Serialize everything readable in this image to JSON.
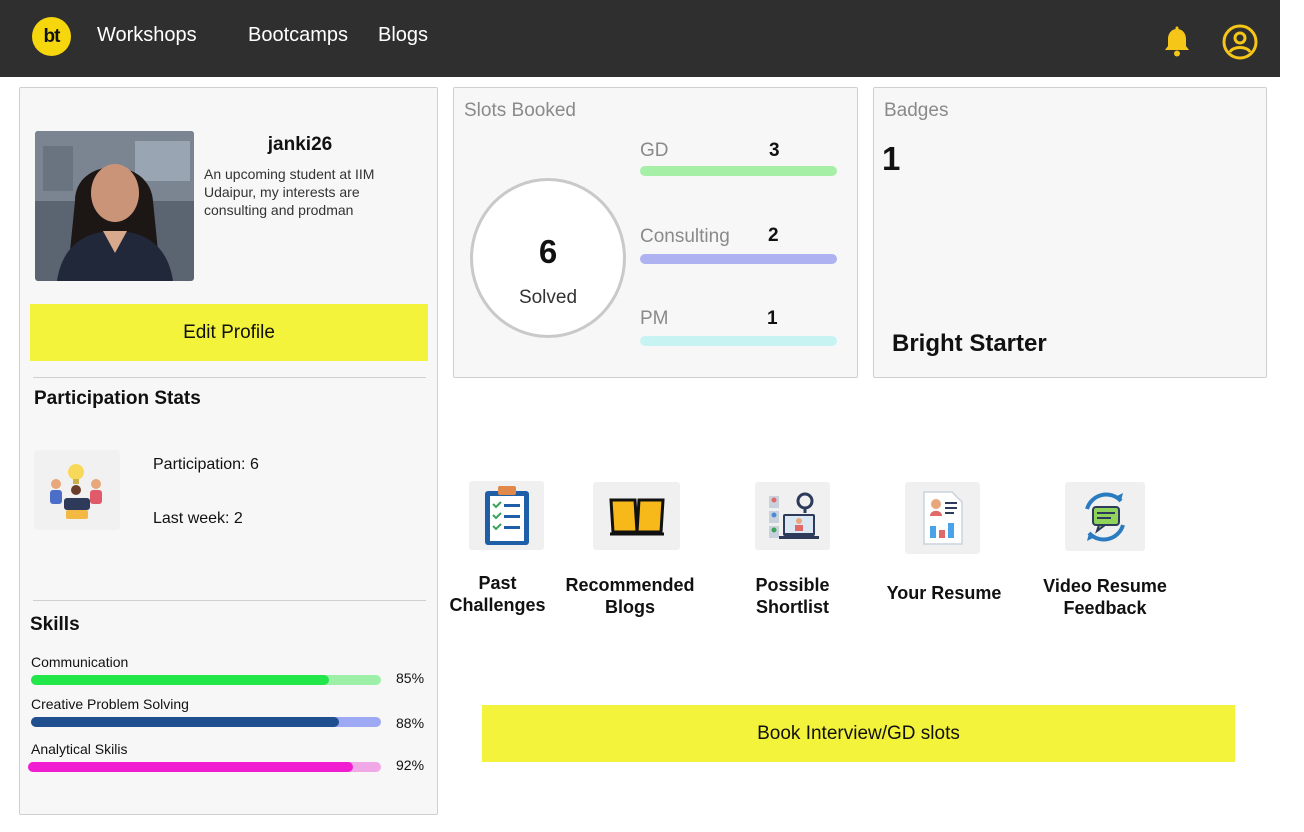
{
  "header": {
    "logo_text": "bt",
    "nav": [
      "Workshops",
      "Bootcamps",
      "Blogs"
    ],
    "icons": [
      "bell-icon",
      "user-account-icon"
    ],
    "background_color": "#2f2f2f",
    "accent_color": "#f6d70e"
  },
  "profile": {
    "username": "janki26",
    "bio": "An upcoming student at IIM Udaipur, my interests are consulting and prodman",
    "edit_label": "Edit Profile"
  },
  "participation": {
    "title": "Participation Stats",
    "participation_text": "Participation: 6",
    "last_week_text": "Last week: 2"
  },
  "skills": {
    "title": "Skills",
    "items": [
      {
        "name": "Communication",
        "percent": 85,
        "percent_label": "85%",
        "fill_color": "#22e64a",
        "track_color": "#9ef0a8"
      },
      {
        "name": "Creative Problem Solving",
        "percent": 88,
        "percent_label": "88%",
        "fill_color": "#1f4f8f",
        "track_color": "#9ea9f3"
      },
      {
        "name": "Analytical Skilis",
        "percent": 92,
        "percent_label": "92%",
        "fill_color": "#f01ed0",
        "track_color": "#f1a8e6"
      }
    ]
  },
  "slots": {
    "title": "Slots Booked",
    "solved_count": "6",
    "solved_label": "Solved",
    "items": [
      {
        "name": "GD",
        "count": "3",
        "color": "#a6efa6"
      },
      {
        "name": "Consulting",
        "count": "2",
        "color": "#aeb2f1"
      },
      {
        "name": "PM",
        "count": "1",
        "color": "#c8f3f3"
      }
    ]
  },
  "badges": {
    "title": "Badges",
    "count": "1",
    "badge_name": "Bright Starter"
  },
  "tiles": [
    {
      "label": "Past Challenges",
      "icon": "clipboard-checklist-icon"
    },
    {
      "label": "Recommended Blogs",
      "icon": "open-book-icon"
    },
    {
      "label": "Possible Shortlist",
      "icon": "candidate-search-icon"
    },
    {
      "label": "Your Resume",
      "icon": "resume-document-icon"
    },
    {
      "label": "Video Resume Feedback",
      "icon": "feedback-cycle-icon"
    }
  ],
  "book_button": "Book Interview/GD slots"
}
